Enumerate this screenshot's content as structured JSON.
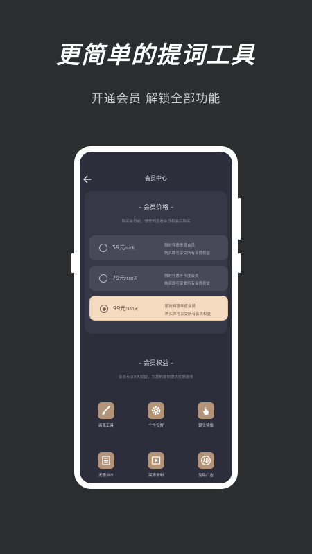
{
  "headline": "更简单的提词工具",
  "subheadline": "开通会员  解锁全部功能",
  "app": {
    "title": "会员中心",
    "price_section": {
      "title": "– 会员价格 –",
      "subtitle": "购买会员前，请仔细查看会员权益后购买",
      "plans": [
        {
          "price": "59元",
          "period": "/90天",
          "desc1": "限时特惠季度会员",
          "desc2": "购买即可享受所有会员权益",
          "selected": false
        },
        {
          "price": "79元",
          "period": "/180天",
          "desc1": "限时特惠半年度会员",
          "desc2": "购买即可享受所有会员权益",
          "selected": false
        },
        {
          "price": "99元",
          "period": "/360天",
          "desc1": "限时特惠年度会员",
          "desc2": "购买即可享受所有会员权益",
          "selected": true
        }
      ]
    },
    "benefits_section": {
      "title": "– 会员权益 –",
      "subtitle": "会员专享8大权益，为您的录制提供优质服务",
      "items": [
        {
          "label": "画笔工具",
          "icon": "brush-icon"
        },
        {
          "label": "个性设置",
          "icon": "gear-icon"
        },
        {
          "label": "镜头镜像",
          "icon": "hand-icon"
        },
        {
          "label": "无限台本",
          "icon": "script-icon"
        },
        {
          "label": "高清录制",
          "icon": "video-icon"
        },
        {
          "label": "免除广告",
          "icon": "ad-icon"
        }
      ]
    }
  },
  "colors": {
    "background": "#2b2d2e",
    "screen": "#2d2e3b",
    "card": "#373847",
    "plan": "#474858",
    "selected_plan": "#f5dcc0",
    "icon_tile": "#b39478"
  }
}
